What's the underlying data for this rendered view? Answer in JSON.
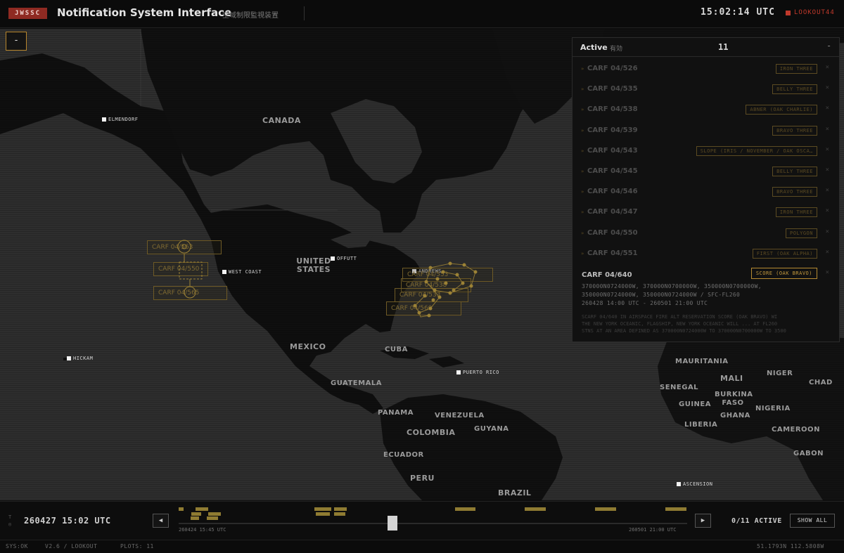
{
  "header": {
    "badge": "JWSSC",
    "title": "Notification System Interface",
    "subtitle": "空域制限監視装置",
    "clock": "15:02:14 UTC",
    "user": "LOOKOUT44"
  },
  "map": {
    "collapse_label": "-",
    "regions": [
      "CANADA",
      "UNITED STATES",
      "MEXICO",
      "CUBA",
      "GUATEMALA",
      "PANAMA",
      "VENEZUELA",
      "GUYANA",
      "COLOMBIA",
      "ECUADOR",
      "PERU",
      "BRAZIL",
      "MAURITANIA",
      "MALI",
      "NIGER",
      "CHAD",
      "SENEGAL",
      "BURKINA FASO",
      "GUINEA",
      "NIGERIA",
      "GHANA",
      "LIBERIA",
      "CAMEROON",
      "GABON"
    ],
    "sites": [
      "ELMENDORF",
      "OFFUTT",
      "WEST COAST",
      "ANDREWS",
      "HICKAM",
      "PUERTO RICO",
      "ASCENSION"
    ],
    "plot_labels": [
      "CARF 04/563",
      "CARF 04/550",
      "CARF 04/565",
      "CARF 04/553",
      "CARF 04/538",
      "CARF 04/533",
      "CARF 04/560"
    ]
  },
  "panel": {
    "title": "Active",
    "subtitle": "有効",
    "count": "11",
    "close_label": "-",
    "chevron": "»",
    "remove": "×",
    "items": [
      {
        "id": "CARF 04/526",
        "tag": "IRON THREE"
      },
      {
        "id": "CARF 04/535",
        "tag": "BELLY THREE"
      },
      {
        "id": "CARF 04/538",
        "tag": "ABNER (OAK CHARLIE)"
      },
      {
        "id": "CARF 04/539",
        "tag": "BRAVO THREE"
      },
      {
        "id": "CARF 04/543",
        "tag": "SLOPE (IRIS / NOVEMBER / OAK OSCA…"
      },
      {
        "id": "CARF 04/545",
        "tag": "BELLY THREE"
      },
      {
        "id": "CARF 04/546",
        "tag": "BRAVO THREE"
      },
      {
        "id": "CARF 04/547",
        "tag": "IRON THREE"
      },
      {
        "id": "CARF 04/550",
        "tag": "POLYGON"
      },
      {
        "id": "CARF 04/551",
        "tag": "FIRST (OAK ALPHA)"
      }
    ],
    "expanded": {
      "id": "CARF 04/640",
      "tag": "SCORE (OAK BRAVO)",
      "coords_1": "370000N0724000W, 370000N0700000W, 350000N0700000W,",
      "coords_2": "350000N0724000W, 350000N0724000W / SFC-FL260",
      "window": "260428 14:00 UTC - 260501 21:00 UTC",
      "desc_1": "SCARF 04/640 IN AIRSPACE FIRE ALT RESERVATION SCORE (OAK BRAVO) WI",
      "desc_2": "THE NEW YORK OCEANIC, FLAGSHIP, NEW YORK OCEANIC WILL ... AT FL260",
      "desc_3": "STNS AT AN AREA DEFINED AS 370000N0724000W TO 370000N0700000W TO 3500"
    }
  },
  "timeline": {
    "glyph": "T\n◎",
    "current": "260427 15:02 UTC",
    "prev": "◀",
    "next": "▶",
    "start": "260424 15:45 UTC",
    "end": "260501 21:00 UTC",
    "progress": 0.42,
    "active": "0/11 ACTIVE",
    "show_all": "SHOW ALL"
  },
  "status": {
    "sys": "SYS:OK",
    "version": "V2.6 / LOOKOUT",
    "plots": "PLOTS: 11",
    "coords": "51.1793N 112.5808W"
  },
  "colors": {
    "accent": "#b8862d",
    "alert": "#c0392b",
    "plot": "#8f7b32"
  }
}
